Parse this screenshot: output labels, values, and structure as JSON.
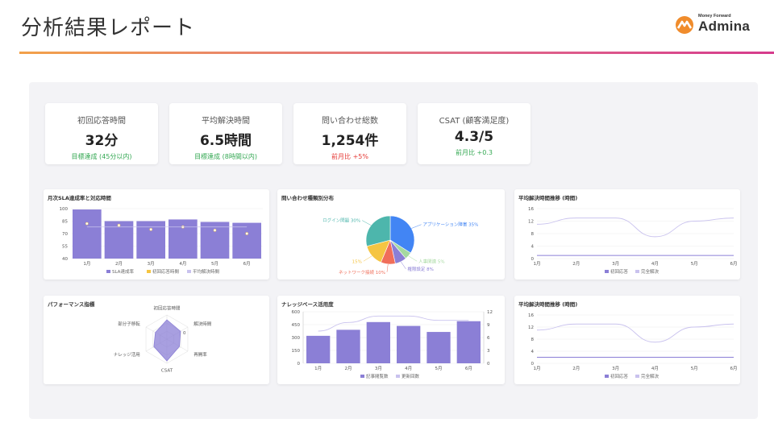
{
  "header": {
    "title": "分析結果レポート",
    "logo_small": "Money Forward",
    "logo_brand": "Admina"
  },
  "colors": {
    "accent": "#8b7fd6",
    "good": "#34a853",
    "bad": "#e53935",
    "logo": "#f08c2c"
  },
  "kpis": [
    {
      "label": "初回応答時間",
      "value": "32分",
      "sub": "目標達成 (45分以内)",
      "sub_color": "#34a853"
    },
    {
      "label": "平均解決時間",
      "value": "6.5時間",
      "sub": "目標達成 (8時間以内)",
      "sub_color": "#34a853"
    },
    {
      "label": "問い合わせ総数",
      "value": "1,254件",
      "sub": "前月比 +5%",
      "sub_color": "#e53935"
    },
    {
      "label": "CSAT (顧客満足度)",
      "value": "4.3/5",
      "sub": "前月比 +0.3",
      "sub_color": "#34a853"
    }
  ],
  "chart_data": [
    {
      "id": "sla",
      "type": "bar",
      "title": "月次SLA達成率と対応時間",
      "categories": [
        "1月",
        "2月",
        "3月",
        "4月",
        "5月",
        "6月"
      ],
      "series": [
        {
          "name": "SLA達成率",
          "values": [
            99,
            85,
            85,
            87,
            84,
            83
          ],
          "color": "#8b7fd6"
        },
        {
          "name": "初回応答時間",
          "values": [
            82,
            80,
            75,
            78,
            74,
            70
          ],
          "color": "#f5c542"
        },
        {
          "name": "平均解決時間",
          "values": [
            78,
            78,
            78,
            78,
            78,
            78
          ],
          "color": "#c9c2ee"
        }
      ],
      "yticks": [
        40,
        55,
        70,
        85,
        100
      ],
      "ylim": [
        40,
        100
      ]
    },
    {
      "id": "pie",
      "type": "pie",
      "title": "問い合わせ種類別分布",
      "slices": [
        {
          "label": "アプリケーション障害 35%",
          "value": 35,
          "color": "#4285f4"
        },
        {
          "label": "人事関連 5%",
          "value": 5,
          "color": "#a6d9a0"
        },
        {
          "label": "権限設定 8%",
          "value": 8,
          "color": "#8b7fd6"
        },
        {
          "label": "ネットワーク接続 10%",
          "value": 10,
          "color": "#f06e5a"
        },
        {
          "label": "15%",
          "value": 15,
          "color": "#f5c542"
        },
        {
          "label": "ログイン問題 30%",
          "value": 30,
          "color": "#4db6ac"
        }
      ]
    },
    {
      "id": "trend1",
      "type": "line",
      "title": "平均解決時間推移 (時間)",
      "categories": [
        "1月",
        "2月",
        "3月",
        "4月",
        "5月",
        "6月"
      ],
      "series": [
        {
          "name": "初回応答",
          "values": [
            1,
            1,
            1,
            1,
            1,
            1
          ],
          "color": "#8b7fd6"
        },
        {
          "name": "完全解決",
          "values": [
            11,
            13,
            13,
            7,
            12,
            13
          ],
          "color": "#c9c2ee"
        }
      ],
      "yticks": [
        0,
        4,
        8,
        12,
        16
      ],
      "ylim": [
        0,
        16
      ]
    },
    {
      "id": "radar",
      "type": "radar",
      "title": "パフォーマンス指標",
      "axes": [
        "初回応答時間",
        "解決時間",
        "再開率",
        "CSAT",
        "ナレッジ活用",
        "部分子移転"
      ],
      "values": [
        0.8,
        0.65,
        0.6,
        0.9,
        0.62,
        0.55
      ],
      "inner_label": "0",
      "color": "#8b7fd6"
    },
    {
      "id": "kb",
      "type": "bar",
      "title": "ナレッジベース活用度",
      "categories": [
        "1月",
        "2月",
        "3月",
        "4月",
        "5月",
        "6月"
      ],
      "series": [
        {
          "name": "記事閲覧数",
          "values": [
            320,
            390,
            480,
            435,
            365,
            490
          ],
          "color": "#8b7fd6"
        },
        {
          "name": "更新回数",
          "values": [
            7.5,
            9.5,
            11,
            11,
            10,
            10
          ],
          "color": "#c9c2ee"
        }
      ],
      "yticks": [
        0,
        150,
        300,
        450,
        600
      ],
      "ylim": [
        0,
        600
      ],
      "y2ticks": [
        0,
        3,
        6,
        9,
        12
      ],
      "y2lim": [
        0,
        12
      ]
    },
    {
      "id": "trend2",
      "type": "line",
      "title": "平均解決時間推移 (時間)",
      "categories": [
        "1月",
        "2月",
        "3月",
        "4月",
        "5月",
        "6月"
      ],
      "series": [
        {
          "name": "初回応答",
          "values": [
            2,
            2,
            2,
            2,
            2,
            2
          ],
          "color": "#8b7fd6"
        },
        {
          "name": "完全解決",
          "values": [
            11,
            13,
            13,
            7,
            12,
            13
          ],
          "color": "#c9c2ee"
        }
      ],
      "yticks": [
        0,
        4,
        8,
        12,
        16
      ],
      "ylim": [
        0,
        16
      ]
    }
  ]
}
